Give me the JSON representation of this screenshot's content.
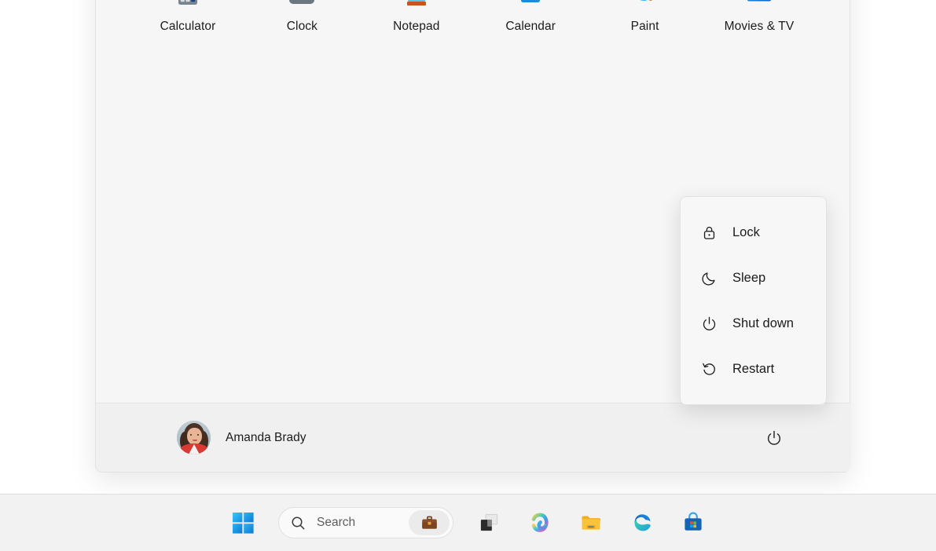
{
  "start_menu": {
    "pinned_apps": [
      {
        "label": "Calculator",
        "icon": "calculator-icon"
      },
      {
        "label": "Clock",
        "icon": "clock-icon"
      },
      {
        "label": "Notepad",
        "icon": "notepad-icon"
      },
      {
        "label": "Calendar",
        "icon": "calendar-icon"
      },
      {
        "label": "Paint",
        "icon": "paint-icon"
      },
      {
        "label": "Movies & TV",
        "icon": "movies-tv-icon"
      }
    ],
    "account": {
      "name": "Amanda Brady",
      "avatar_icon": "user-avatar"
    },
    "power_button_icon": "power-icon"
  },
  "power_menu": {
    "items": [
      {
        "label": "Lock",
        "icon": "lock-icon"
      },
      {
        "label": "Sleep",
        "icon": "moon-icon"
      },
      {
        "label": "Shut down",
        "icon": "power-icon"
      },
      {
        "label": "Restart",
        "icon": "restart-icon"
      }
    ]
  },
  "taskbar": {
    "start_button": {
      "label": "Start",
      "icon": "windows-logo-icon"
    },
    "search": {
      "placeholder": "Search",
      "value": "",
      "icon": "search-icon",
      "chip_icon": "briefcase-icon"
    },
    "items": [
      {
        "label": "Task View",
        "icon": "task-view-icon"
      },
      {
        "label": "Copilot",
        "icon": "copilot-icon"
      },
      {
        "label": "File Explorer",
        "icon": "folder-icon"
      },
      {
        "label": "Microsoft Edge",
        "icon": "edge-icon"
      },
      {
        "label": "Microsoft Store",
        "icon": "store-icon"
      }
    ]
  },
  "colors": {
    "accent": "#0078d4",
    "panel_bg": "#f6f6f6",
    "taskbar_bg": "#f2f2f2",
    "text": "#1b1b1b"
  }
}
